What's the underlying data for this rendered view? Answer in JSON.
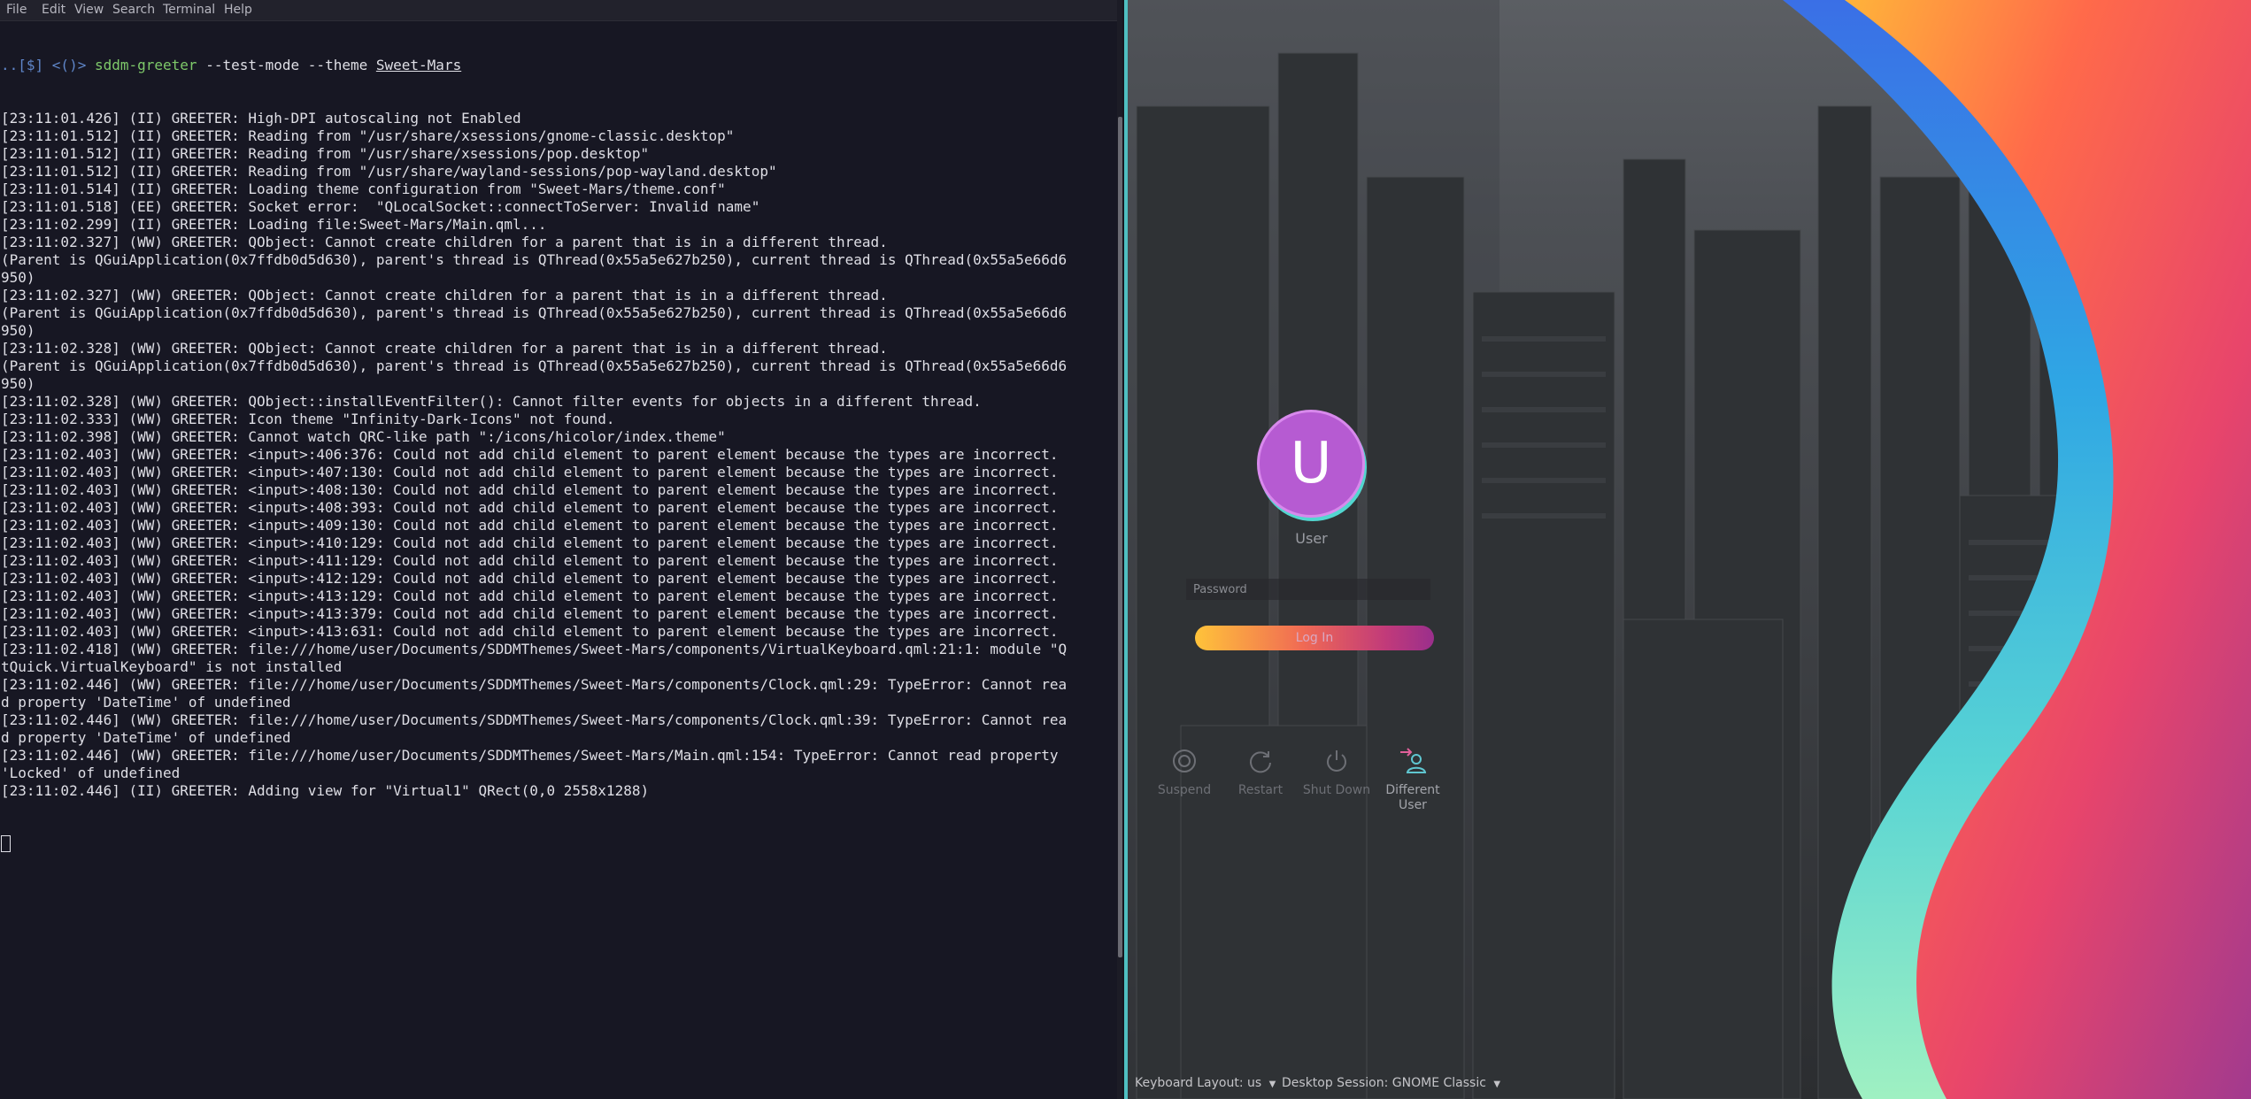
{
  "menubar": {
    "items": [
      "File",
      "Edit",
      "View",
      "Search",
      "Terminal",
      "Help"
    ]
  },
  "terminal": {
    "prompt": "..[$] <()>",
    "command": "sddm-greeter",
    "args": "--test-mode --theme",
    "theme_arg": "Sweet-Mars",
    "lines": [
      "[23:11:01.426] (II) GREETER: High-DPI autoscaling not Enabled",
      "[23:11:01.512] (II) GREETER: Reading from \"/usr/share/xsessions/gnome-classic.desktop\"",
      "[23:11:01.512] (II) GREETER: Reading from \"/usr/share/xsessions/pop.desktop\"",
      "[23:11:01.512] (II) GREETER: Reading from \"/usr/share/wayland-sessions/pop-wayland.desktop\"",
      "[23:11:01.514] (II) GREETER: Loading theme configuration from \"Sweet-Mars/theme.conf\"",
      "[23:11:01.518] (EE) GREETER: Socket error:  \"QLocalSocket::connectToServer: Invalid name\"",
      "[23:11:02.299] (II) GREETER: Loading file:Sweet-Mars/Main.qml...",
      "[23:11:02.327] (WW) GREETER: QObject: Cannot create children for a parent that is in a different thread.",
      "(Parent is QGuiApplication(0x7ffdb0d5d630), parent's thread is QThread(0x55a5e627b250), current thread is QThread(0x55a5e66d6",
      "950)",
      "[23:11:02.327] (WW) GREETER: QObject: Cannot create children for a parent that is in a different thread.",
      "(Parent is QGuiApplication(0x7ffdb0d5d630), parent's thread is QThread(0x55a5e627b250), current thread is QThread(0x55a5e66d6",
      "950)",
      "[23:11:02.328] (WW) GREETER: QObject: Cannot create children for a parent that is in a different thread.",
      "(Parent is QGuiApplication(0x7ffdb0d5d630), parent's thread is QThread(0x55a5e627b250), current thread is QThread(0x55a5e66d6",
      "950)",
      "[23:11:02.328] (WW) GREETER: QObject::installEventFilter(): Cannot filter events for objects in a different thread.",
      "[23:11:02.333] (WW) GREETER: Icon theme \"Infinity-Dark-Icons\" not found.",
      "[23:11:02.398] (WW) GREETER: Cannot watch QRC-like path \":/icons/hicolor/index.theme\"",
      "[23:11:02.403] (WW) GREETER: <input>:406:376: Could not add child element to parent element because the types are incorrect.",
      "[23:11:02.403] (WW) GREETER: <input>:407:130: Could not add child element to parent element because the types are incorrect.",
      "[23:11:02.403] (WW) GREETER: <input>:408:130: Could not add child element to parent element because the types are incorrect.",
      "[23:11:02.403] (WW) GREETER: <input>:408:393: Could not add child element to parent element because the types are incorrect.",
      "[23:11:02.403] (WW) GREETER: <input>:409:130: Could not add child element to parent element because the types are incorrect.",
      "[23:11:02.403] (WW) GREETER: <input>:410:129: Could not add child element to parent element because the types are incorrect.",
      "[23:11:02.403] (WW) GREETER: <input>:411:129: Could not add child element to parent element because the types are incorrect.",
      "[23:11:02.403] (WW) GREETER: <input>:412:129: Could not add child element to parent element because the types are incorrect.",
      "[23:11:02.403] (WW) GREETER: <input>:413:129: Could not add child element to parent element because the types are incorrect.",
      "[23:11:02.403] (WW) GREETER: <input>:413:379: Could not add child element to parent element because the types are incorrect.",
      "[23:11:02.403] (WW) GREETER: <input>:413:631: Could not add child element to parent element because the types are incorrect.",
      "[23:11:02.418] (WW) GREETER: file:///home/user/Documents/SDDMThemes/Sweet-Mars/components/VirtualKeyboard.qml:21:1: module \"Q",
      "tQuick.VirtualKeyboard\" is not installed",
      "[23:11:02.446] (WW) GREETER: file:///home/user/Documents/SDDMThemes/Sweet-Mars/components/Clock.qml:29: TypeError: Cannot rea",
      "d property 'DateTime' of undefined",
      "[23:11:02.446] (WW) GREETER: file:///home/user/Documents/SDDMThemes/Sweet-Mars/components/Clock.qml:39: TypeError: Cannot rea",
      "d property 'DateTime' of undefined",
      "[23:11:02.446] (WW) GREETER: file:///home/user/Documents/SDDMThemes/Sweet-Mars/Main.qml:154: TypeError: Cannot read property",
      "'Locked' of undefined",
      "[23:11:02.446] (II) GREETER: Adding view for \"Virtual1\" QRect(0,0 2558x1288)"
    ]
  },
  "greeter": {
    "avatar_letter": "U",
    "username": "User",
    "password_placeholder": "Password",
    "login_label": "Log In",
    "power": {
      "suspend": "Suspend",
      "restart": "Restart",
      "shutdown": "Shut Down",
      "different_user": "Different User"
    },
    "keyboard_layout": "Keyboard Layout: us",
    "session": "Desktop Session: GNOME Classic"
  },
  "colors": {
    "accent_teal": "#4fbfc1",
    "avatar": "#b65bd2",
    "gradient_yellow": "#ffc33a",
    "gradient_pink": "#e8456b",
    "gradient_blue": "#2f8fe8",
    "gradient_mint": "#8fe8c6"
  },
  "icons": [
    "suspend-icon",
    "restart-icon",
    "power-icon",
    "different-user-icon",
    "chevron-down-icon"
  ]
}
